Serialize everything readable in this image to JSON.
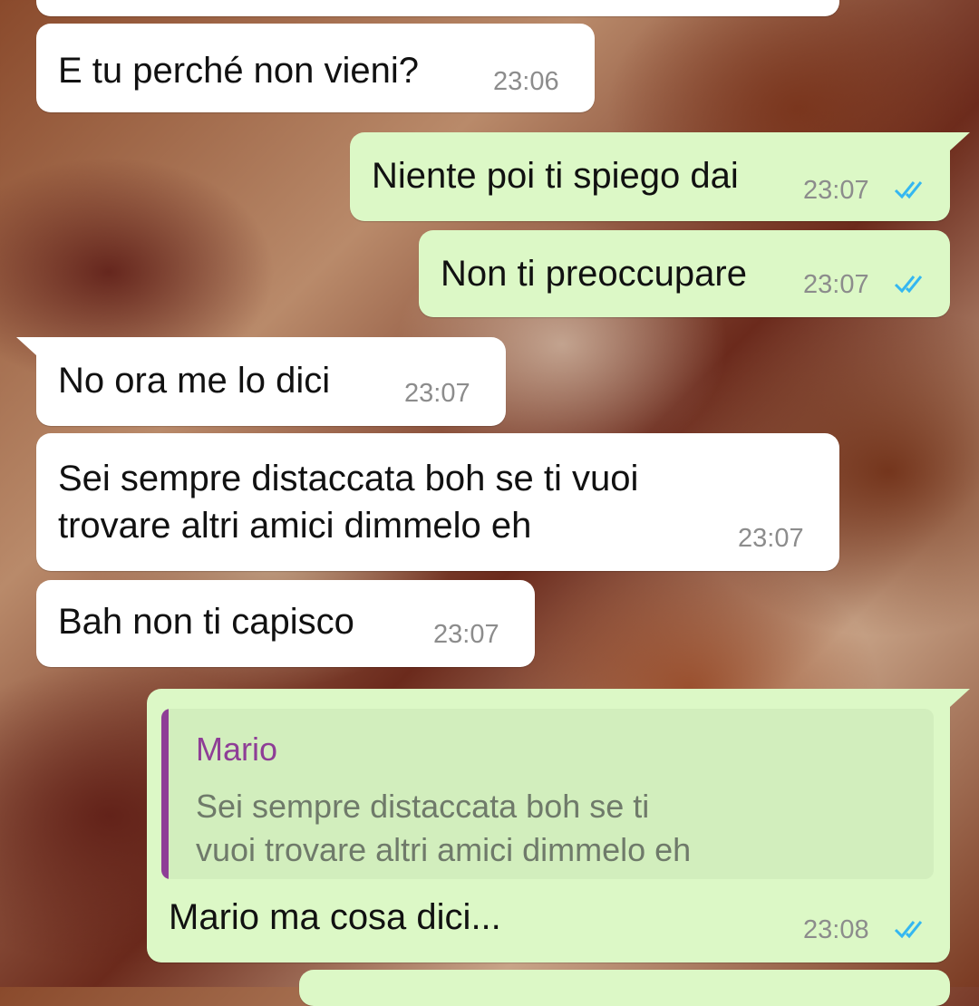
{
  "messages": [
    {
      "text": "E tu perché non vieni?",
      "time": "23:06"
    },
    {
      "text": "Niente poi ti spiego dai",
      "time": "23:07"
    },
    {
      "text": "Non ti preoccupare",
      "time": "23:07"
    },
    {
      "text": "No ora me lo dici",
      "time": "23:07"
    },
    {
      "text": "Sei sempre distaccata boh se ti vuoi\ntrovare altri amici dimmelo eh",
      "time": "23:07"
    },
    {
      "text": "Bah non ti capisco",
      "time": "23:07"
    },
    {
      "quote_author": "Mario",
      "quote_text": "Sei sempre distaccata boh se ti\nvuoi trovare altri amici dimmelo eh",
      "text": "Mario ma cosa dici...",
      "time": "23:08"
    }
  ],
  "colors": {
    "incoming_bubble": "#ffffff",
    "outgoing_bubble": "#dcf8c6",
    "read_ticks": "#34b7f1",
    "quote_author": "#8e3e96"
  },
  "icons": {
    "read_receipt": "double-check-icon"
  }
}
